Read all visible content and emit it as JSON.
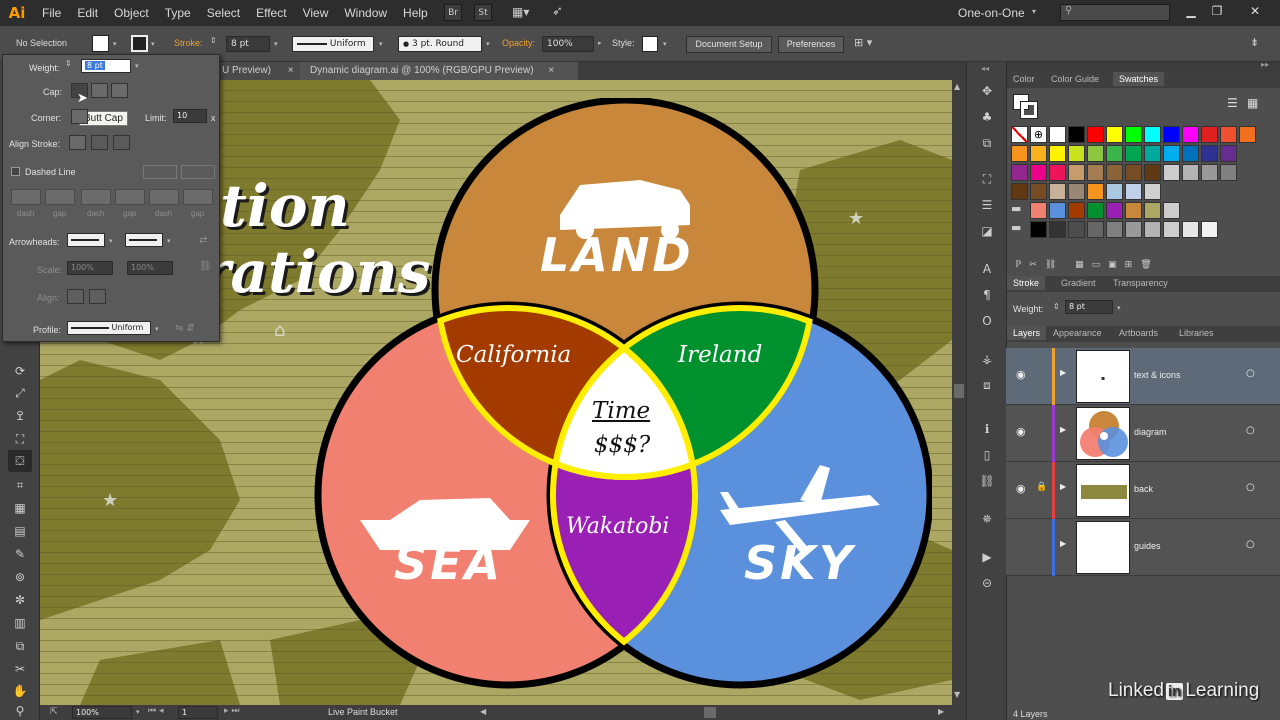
{
  "app": {
    "logo": "Ai",
    "workspace": "One-on-One"
  },
  "menu": [
    "File",
    "Edit",
    "Object",
    "Type",
    "Select",
    "Effect",
    "View",
    "Window",
    "Help"
  ],
  "menubar_buttons": [
    "Br",
    "St"
  ],
  "control_bar": {
    "selection": "No Selection",
    "stroke_label": "Stroke:",
    "stroke_weight": "8 pt",
    "profile": "Uniform",
    "brush": "3 pt. Round",
    "opacity_label": "Opacity:",
    "opacity": "100%",
    "style_label": "Style:",
    "document_setup": "Document Setup",
    "preferences": "Preferences"
  },
  "tabs": [
    {
      "label": "U Preview)",
      "close": "×"
    },
    {
      "label": "Dynamic diagram.ai @ 100% (RGB/GPU Preview)",
      "close": "×"
    }
  ],
  "stroke_popup": {
    "weight_label": "Weight:",
    "weight_value": "8 pt",
    "cap_label": "Cap:",
    "corner_label": "Corner:",
    "limit_label": "Limit:",
    "limit_value": "10",
    "limit_unit": "x",
    "align_label": "Align Stroke:",
    "dashed_label": "Dashed Line",
    "dash_labels": [
      "dash",
      "gap",
      "dash",
      "gap",
      "dash",
      "gap"
    ],
    "arrowheads_label": "Arrowheads:",
    "scale_label": "Scale:",
    "scale_1": "100%",
    "scale_2": "100%",
    "align_arrow_label": "Align:",
    "profile_label": "Profile:",
    "profile_value": "Uniform",
    "tooltip": "Butt Cap"
  },
  "artwork": {
    "title_line1": "tion",
    "title_line2": "rations",
    "circle_labels": {
      "land": "LAND",
      "sea": "SEA",
      "sky": "SKY"
    },
    "overlap_labels": {
      "land_sea": "California",
      "land_sky": "Ireland",
      "sea_sky": "Wakatobi"
    },
    "center_line1": "Time",
    "center_line2": "$$$?",
    "colors": {
      "land": "#c8873a",
      "sea": "#f28071",
      "sky": "#5b90dd",
      "california": "#a33a00",
      "ireland": "#00912f",
      "wakatobi": "#9a1fb5",
      "outline": "#ffee00"
    }
  },
  "panel": {
    "color_tabs": [
      "Color",
      "Color Guide",
      "Swatches"
    ],
    "stroke_tabs": [
      "Stroke",
      "Gradient",
      "Transparency"
    ],
    "stroke_weight_label": "Weight:",
    "stroke_weight_value": "8 pt",
    "layer_tabs": [
      "Layers",
      "Appearance",
      "Artboards",
      "Libraries"
    ],
    "layers": [
      {
        "name": "text & icons",
        "color": "#f0a030"
      },
      {
        "name": "diagram",
        "color": "#9a3ad0"
      },
      {
        "name": "back",
        "color": "#e04040"
      },
      {
        "name": "guides",
        "color": "#4070e0"
      }
    ],
    "layer_count": "4 Layers"
  },
  "status_bar": {
    "zoom": "100%",
    "artboard": "1",
    "tool": "Live Paint Bucket"
  },
  "watermark": {
    "brand_a": "Linked",
    "brand_in": "in",
    "brand_b": "Learning"
  }
}
